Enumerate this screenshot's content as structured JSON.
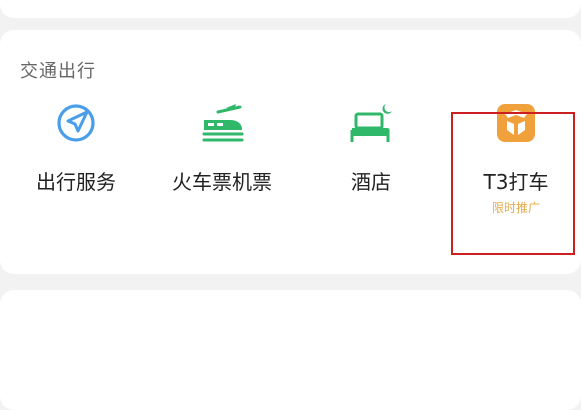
{
  "section": {
    "title": "交通出行"
  },
  "items": [
    {
      "label": "出行服务",
      "icon": "navigation-arrow-icon",
      "color": "#4a9de8"
    },
    {
      "label": "火车票机票",
      "icon": "train-plane-icon",
      "color": "#2fb86a"
    },
    {
      "label": "酒店",
      "icon": "hotel-bed-icon",
      "color": "#2fb86a"
    },
    {
      "label": "T3打车",
      "sublabel": "限时推广",
      "icon": "t3-taxi-logo-icon",
      "color": "#f0a13c"
    }
  ],
  "colors": {
    "background": "#f2f2f2",
    "card": "#ffffff",
    "promo": "#e8a94b",
    "highlight_border": "#cc1f1f"
  }
}
